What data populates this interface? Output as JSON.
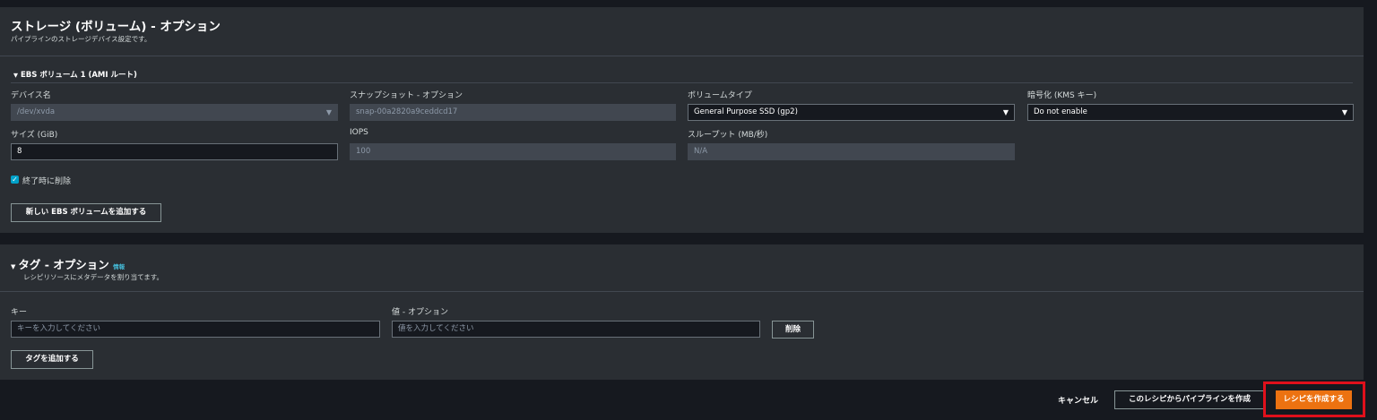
{
  "storage": {
    "title": "ストレージ (ボリューム) - オプション",
    "description": "パイプラインのストレージデバイス設定です。",
    "volume": {
      "header": "EBS ボリューム 1 (AMI ルート)",
      "device_label": "デバイス名",
      "device_value": "/dev/xvda",
      "snapshot_label": "スナップショット - オプション",
      "snapshot_value": "snap-00a2820a9ceddcd17",
      "volume_type_label": "ボリュームタイプ",
      "volume_type_value": "General Purpose SSD (gp2)",
      "encryption_label": "暗号化 (KMS キー)",
      "encryption_value": "Do not enable",
      "size_label": "サイズ (GiB)",
      "size_value": "8",
      "iops_label": "IOPS",
      "iops_value": "100",
      "throughput_label": "スループット (MB/秒)",
      "throughput_value": "N/A",
      "delete_on_termination_label": "終了時に削除",
      "delete_on_termination_checked": true
    },
    "add_volume_button": "新しい EBS ボリュームを追加する"
  },
  "tags": {
    "title": "タグ - オプション",
    "info_link": "情報",
    "description": "レシピリソースにメタデータを割り当てます。",
    "key_label": "キー",
    "key_placeholder": "キーを入力してください",
    "value_label": "値 - オプション",
    "value_placeholder": "値を入力してください",
    "remove_button": "削除",
    "add_tag_button": "タグを追加する"
  },
  "footer": {
    "cancel_button": "キャンセル",
    "create_pipeline_button": "このレシピからパイプラインを作成",
    "create_recipe_button": "レシピを作成する"
  },
  "icons": {
    "collapse": "▼",
    "dropdown": "▼",
    "check": "✓"
  },
  "colors": {
    "background": "#16191f",
    "panel": "#2a2e33",
    "primary": "#ec7211",
    "checkbox": "#00a1c9",
    "highlight": "#e0101b"
  }
}
